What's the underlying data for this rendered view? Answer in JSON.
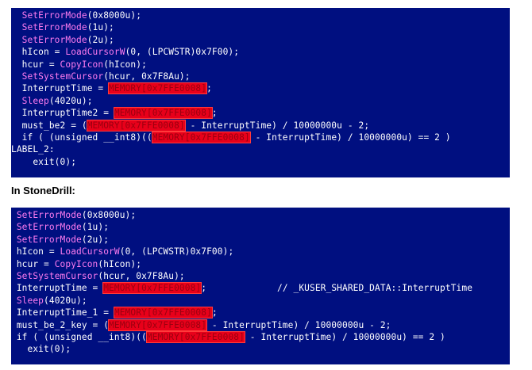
{
  "block1": {
    "l01": {
      "fn": "SetErrorMode",
      "rest": "(0x8000u);"
    },
    "l02": {
      "fn": "SetErrorMode",
      "rest": "(1u);"
    },
    "l03": {
      "fn": "SetErrorMode",
      "rest": "(2u);"
    },
    "l04": {
      "pre": "hIcon = ",
      "fn": "LoadCursorW",
      "rest": "(0, (LPCWSTR)0x7F00);"
    },
    "l05": {
      "pre": "hcur = ",
      "fn": "CopyIcon",
      "rest": "(hIcon);"
    },
    "l06": {
      "fn": "SetSystemCursor",
      "rest": "(hcur, 0x7F8Au);"
    },
    "l07": {
      "pre": "InterruptTime = ",
      "hl": "MEMORY[0x7FFE0008]",
      "rest": ";"
    },
    "l08": {
      "fn": "Sleep",
      "rest": "(4020u);"
    },
    "l09": {
      "pre": "InterruptTime2 = ",
      "hl": "MEMORY[0x7FFE0008]",
      "rest": ";"
    },
    "l10": {
      "pre": "must_be2 = (",
      "hl": "MEMORY[0x7FFE0008]",
      "rest": " - InterruptTime) / 10000000u - 2;"
    },
    "l11": {
      "pre": "if ( (unsigned __int8)((",
      "hl": "MEMORY[0x7FFE0008]",
      "rest": " - InterruptTime) / 10000000u) == 2 )"
    },
    "l12": {
      "text": "LABEL_2:"
    },
    "l13": {
      "text": "exit(0);"
    }
  },
  "heading": "In StoneDrill:",
  "block2": {
    "l01": {
      "fn": "SetErrorMode",
      "rest": "(0x8000u);"
    },
    "l02": {
      "fn": "SetErrorMode",
      "rest": "(1u);"
    },
    "l03": {
      "fn": "SetErrorMode",
      "rest": "(2u);"
    },
    "l04": {
      "pre": "hIcon = ",
      "fn": "LoadCursorW",
      "rest": "(0, (LPCWSTR)0x7F00);"
    },
    "l05": {
      "pre": "hcur = ",
      "fn": "CopyIcon",
      "rest": "(hIcon);"
    },
    "l06": {
      "fn": "SetSystemCursor",
      "rest": "(hcur, 0x7F8Au);"
    },
    "l07": {
      "pre": "InterruptTime = ",
      "hl": "MEMORY[0x7FFE0008]",
      "rest": ";",
      "comment": "// _KUSER_SHARED_DATA::InterruptTime"
    },
    "l08": {
      "fn": "Sleep",
      "rest": "(4020u);"
    },
    "l09": {
      "pre": "InterruptTime_1 = ",
      "hl": "MEMORY[0x7FFE0008]",
      "rest": ";"
    },
    "l10": {
      "pre": "must_be_2_key = (",
      "hl": "MEMORY[0x7FFE0008]",
      "rest": " - InterruptTime) / 10000000u - 2;"
    },
    "l11": {
      "pre": "if ( (unsigned __int8)((",
      "hl": "MEMORY[0x7FFE0008]",
      "rest": " - InterruptTime) / 10000000u) == 2 )"
    },
    "l12": {
      "text": "exit(0);"
    }
  },
  "colors": {
    "background": "#000f80",
    "function": "#ff7cf0",
    "highlight": "#e8001a",
    "text": "#ffffff"
  }
}
